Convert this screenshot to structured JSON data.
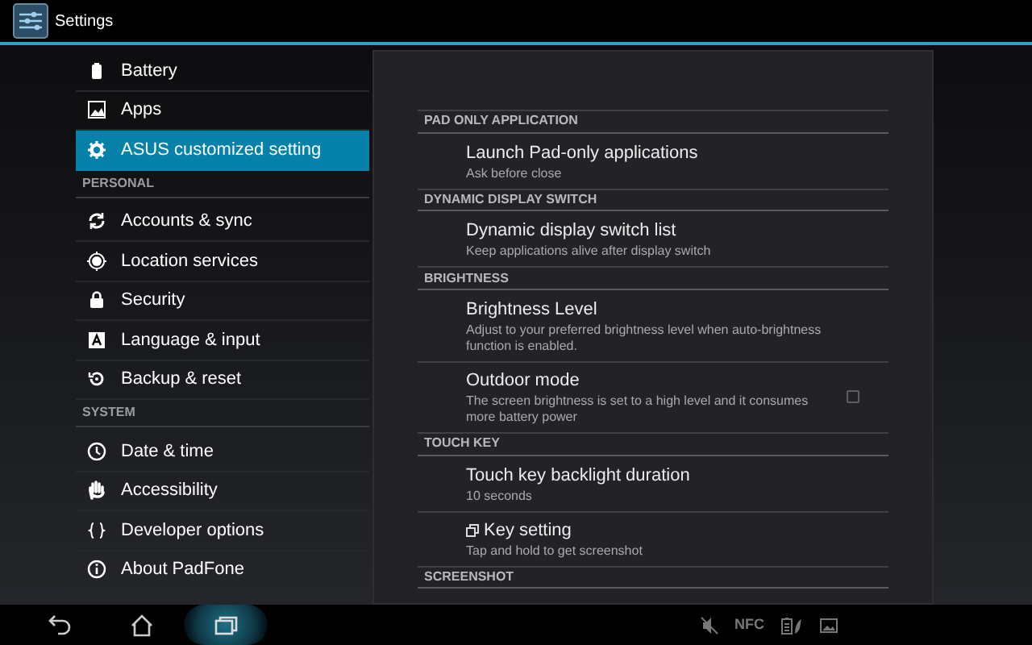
{
  "window": {
    "title": "Settings"
  },
  "sidebar": {
    "items": [
      {
        "kind": "item",
        "label": "Battery",
        "selected": false
      },
      {
        "kind": "item",
        "label": "Apps",
        "selected": false
      },
      {
        "kind": "item",
        "label": "ASUS customized setting",
        "selected": true
      },
      {
        "kind": "header",
        "label": "PERSONAL"
      },
      {
        "kind": "item",
        "label": "Accounts & sync",
        "selected": false
      },
      {
        "kind": "item",
        "label": "Location services",
        "selected": false
      },
      {
        "kind": "item",
        "label": "Security",
        "selected": false
      },
      {
        "kind": "item",
        "label": "Language & input",
        "selected": false
      },
      {
        "kind": "item",
        "label": "Backup & reset",
        "selected": false
      },
      {
        "kind": "header",
        "label": "SYSTEM"
      },
      {
        "kind": "item",
        "label": "Date & time",
        "selected": false
      },
      {
        "kind": "item",
        "label": "Accessibility",
        "selected": false
      },
      {
        "kind": "item",
        "label": "Developer options",
        "selected": false
      },
      {
        "kind": "item",
        "label": "About PadFone",
        "selected": false
      }
    ]
  },
  "panel": {
    "sections": [
      {
        "header": "PAD ONLY APPLICATION",
        "items": [
          {
            "kind": "plain",
            "title": "Launch Pad-only applications",
            "summary": "Ask before close"
          }
        ]
      },
      {
        "header": "DYNAMIC DISPLAY SWITCH",
        "items": [
          {
            "kind": "plain",
            "title": "Dynamic display switch list",
            "summary": "Keep applications alive after display switch"
          }
        ]
      },
      {
        "header": "BRIGHTNESS",
        "items": [
          {
            "kind": "plain",
            "title": "Brightness Level",
            "summary": "Adjust to your preferred brightness level when auto-brightness function is enabled."
          },
          {
            "kind": "checkbox",
            "title": "Outdoor mode",
            "summary": "The screen brightness is set to a high level and it consumes more battery power",
            "checked": false
          }
        ]
      },
      {
        "header": "TOUCH KEY",
        "items": [
          {
            "kind": "plain",
            "title": "Touch key backlight duration",
            "summary": "10 seconds"
          },
          {
            "kind": "icon",
            "title": "Key setting",
            "summary": "Tap and hold to get screenshot"
          }
        ]
      },
      {
        "header": "SCREENSHOT"
      }
    ]
  },
  "navigation_bar": {
    "buttons": [
      {
        "kind": "back",
        "selected": false
      },
      {
        "kind": "home",
        "selected": false
      },
      {
        "kind": "recents",
        "selected": true
      }
    ],
    "nfc": "NFC"
  }
}
